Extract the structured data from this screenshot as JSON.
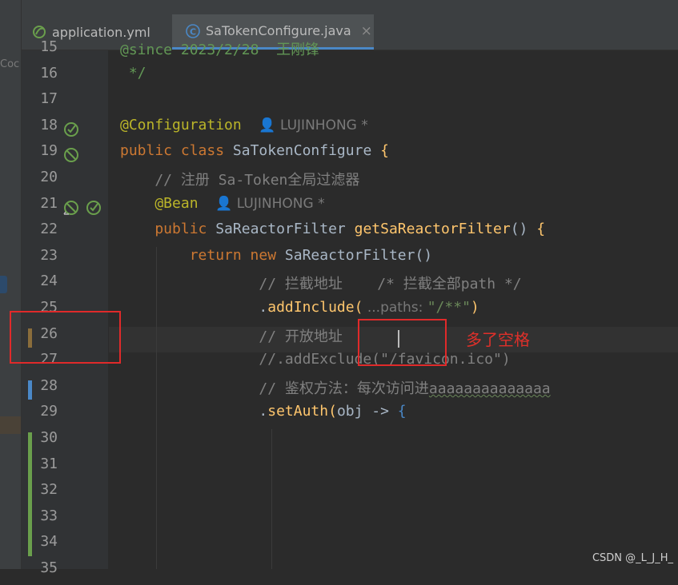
{
  "side_text": "Coc",
  "tabs": [
    {
      "label": "application.yml",
      "icon": "spring-leaf-icon",
      "active": false
    },
    {
      "label": "SaTokenConfigure.java",
      "icon": "java-class-icon",
      "active": true,
      "close": "×"
    }
  ],
  "lines": [
    {
      "n": "15",
      "src": [
        {
          "t": "@since",
          "c": "cmdoc"
        },
        {
          "t": " 2023/2/28  王刚锋",
          "c": "cmdoc"
        }
      ]
    },
    {
      "n": "16",
      "src": [
        {
          "t": " */",
          "c": "cmdoc"
        }
      ]
    },
    {
      "n": "17",
      "src": []
    },
    {
      "n": "18",
      "src": [
        {
          "t": "@Configuration",
          "c": "ann"
        },
        {
          "t": "  ",
          "c": "cls"
        },
        {
          "t": "👤 LUJINHONG *",
          "c": "meta"
        }
      ]
    },
    {
      "n": "19",
      "src": [
        {
          "t": "public class ",
          "c": "kw"
        },
        {
          "t": "SaTokenConfigure ",
          "c": "cls"
        },
        {
          "t": "{",
          "c": "fn"
        }
      ]
    },
    {
      "n": "20",
      "src": [
        {
          "t": "    // 注册 Sa-Token全局过滤器",
          "c": "cm"
        }
      ]
    },
    {
      "n": "21",
      "src": [
        {
          "t": "    @Bean",
          "c": "ann"
        },
        {
          "t": "  ",
          "c": "cls"
        },
        {
          "t": "👤 LUJINHONG *",
          "c": "meta"
        }
      ]
    },
    {
      "n": "22",
      "src": [
        {
          "t": "    public ",
          "c": "kw"
        },
        {
          "t": "SaReactorFilter ",
          "c": "cls"
        },
        {
          "t": "getSaReactorFilter",
          "c": "fn"
        },
        {
          "t": "() ",
          "c": "cls"
        },
        {
          "t": "{",
          "c": "fn"
        }
      ]
    },
    {
      "n": "23",
      "src": [
        {
          "t": "        return new ",
          "c": "kw"
        },
        {
          "t": "SaReactorFilter()",
          "c": "cls"
        }
      ]
    },
    {
      "n": "24",
      "src": [
        {
          "t": "                // 拦截地址    /* 拦截全部path */",
          "c": "cm"
        }
      ]
    },
    {
      "n": "25",
      "src": [
        {
          "t": "                .",
          "c": "cls"
        },
        {
          "t": "addInclude(",
          "c": "fn"
        },
        {
          "t": " ...paths: ",
          "c": "hint"
        },
        {
          "t": "\"/**\"",
          "c": "str"
        },
        {
          "t": ")",
          "c": "fn"
        }
      ]
    },
    {
      "n": "26",
      "src": [
        {
          "t": "                // 开放地址",
          "c": "cm"
        }
      ]
    },
    {
      "n": "27",
      "src": [
        {
          "t": "                //.addExclude(\"/favicon.ico\")",
          "c": "cm"
        }
      ]
    },
    {
      "n": "28",
      "src": [
        {
          "t": "                // 鉴权方法：每次访问进",
          "c": "cm"
        },
        {
          "t": "aaaaaaaaaaaaaa",
          "c": "cm squig"
        }
      ]
    },
    {
      "n": "29",
      "src": [
        {
          "t": "                .",
          "c": "cls"
        },
        {
          "t": "setAuth(",
          "c": "fn"
        },
        {
          "t": "obj -> ",
          "c": "cls"
        },
        {
          "t": "{",
          "c": "brace"
        }
      ]
    },
    {
      "n": "30",
      "src": []
    },
    {
      "n": "31",
      "src": []
    },
    {
      "n": "32",
      "src": []
    },
    {
      "n": "33",
      "src": []
    },
    {
      "n": "34",
      "src": []
    },
    {
      "n": "35",
      "src": []
    }
  ],
  "gutter_icons": [
    {
      "line": "18",
      "icons": [
        "spring-bean-icon"
      ]
    },
    {
      "line": "19",
      "icons": [
        "spring-config-icon"
      ]
    },
    {
      "line": "21",
      "icons": [
        "spring-config-arrow-icon",
        "spring-bean-icon"
      ]
    }
  ],
  "vcs_markers": [
    {
      "line": "26",
      "kind": "modified",
      "color": "#8a6d3b"
    },
    {
      "line": "28",
      "kind": "changed",
      "color": "#4a88c7"
    },
    {
      "lines": [
        "30",
        "31",
        "32",
        "33",
        "34"
      ],
      "kind": "added",
      "color": "#6a9f4c"
    }
  ],
  "annotation_note": "多了空格",
  "watermark": "CSDN @_L_J_H_",
  "colors": {
    "annotation_red": "#e02a2a",
    "editor_bg": "#2b2b2b",
    "gutter_bg": "#313335"
  }
}
